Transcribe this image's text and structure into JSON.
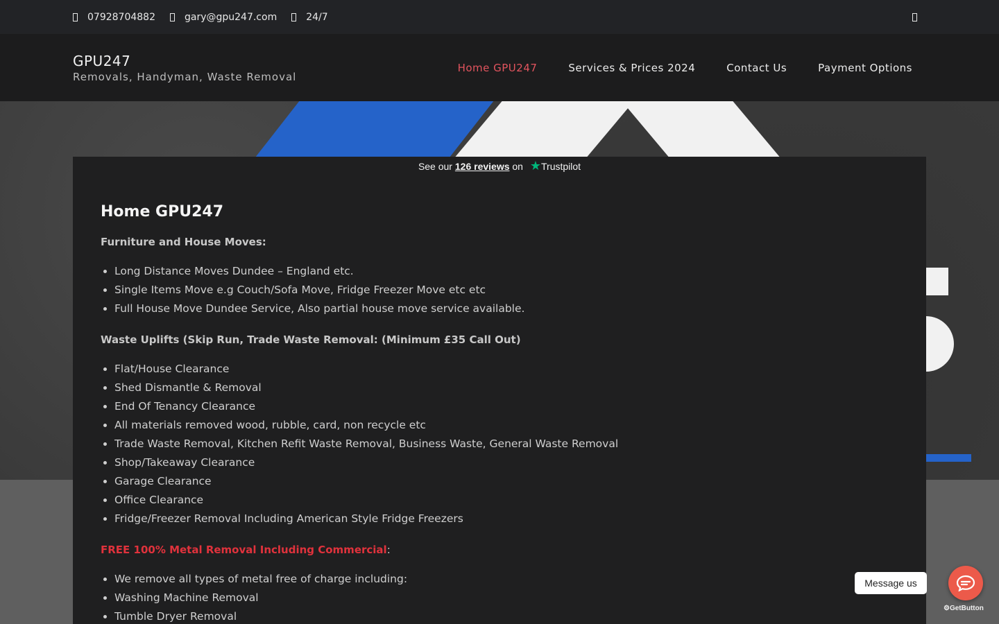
{
  "topbar": {
    "phone": "07928704882",
    "email": "gary@gpu247.com",
    "hours": "24/7"
  },
  "header": {
    "site_title": "GPU247",
    "site_description": "Removals, Handyman, Waste Removal",
    "nav": [
      {
        "label": "Home GPU247",
        "active": true
      },
      {
        "label": "Services & Prices 2024"
      },
      {
        "label": "Contact Us"
      },
      {
        "label": "Payment Options"
      }
    ]
  },
  "trustpilot": {
    "prefix": "See our",
    "reviews_link": "126 reviews",
    "suffix": "on",
    "brand": "Trustpilot"
  },
  "main": {
    "page_title": "Home GPU247",
    "sections": [
      {
        "title": "Furniture and House Moves:",
        "items": [
          "Long Distance Moves Dundee – England etc.",
          "Single Items Move e.g Couch/Sofa Move, Fridge Freezer Move etc etc",
          "Full House Move Dundee Service, Also partial house move service available."
        ]
      },
      {
        "title": "Waste Uplifts (Skip Run, Trade Waste Removal: (Minimum £35 Call Out)",
        "items": [
          "Flat/House Clearance",
          "Shed Dismantle & Removal",
          "End Of Tenancy Clearance",
          "All materials removed wood, rubble, card, non recycle etc",
          "Trade Waste Removal, Kitchen Refit Waste Removal, Business Waste, General Waste Removal",
          "Shop/Takeaway Clearance",
          "Garage Clearance",
          "Office Clearance",
          "Fridge/Freezer Removal Including American Style Fridge Freezers"
        ]
      },
      {
        "title": "FREE 100% Metal Removal Including Commercial",
        "title_suffix": ":",
        "items": [
          "We remove all types of metal free of charge including:",
          "Washing Machine Removal",
          "Tumble Dryer Removal"
        ]
      }
    ]
  },
  "widget": {
    "message_label": "Message us",
    "powered_by": "GetButton"
  },
  "colors": {
    "accent_red": "#e0323c",
    "nav_active": "#e2545e",
    "trustpilot_green": "#00b67a",
    "chat_button": "#ec5a4a"
  }
}
